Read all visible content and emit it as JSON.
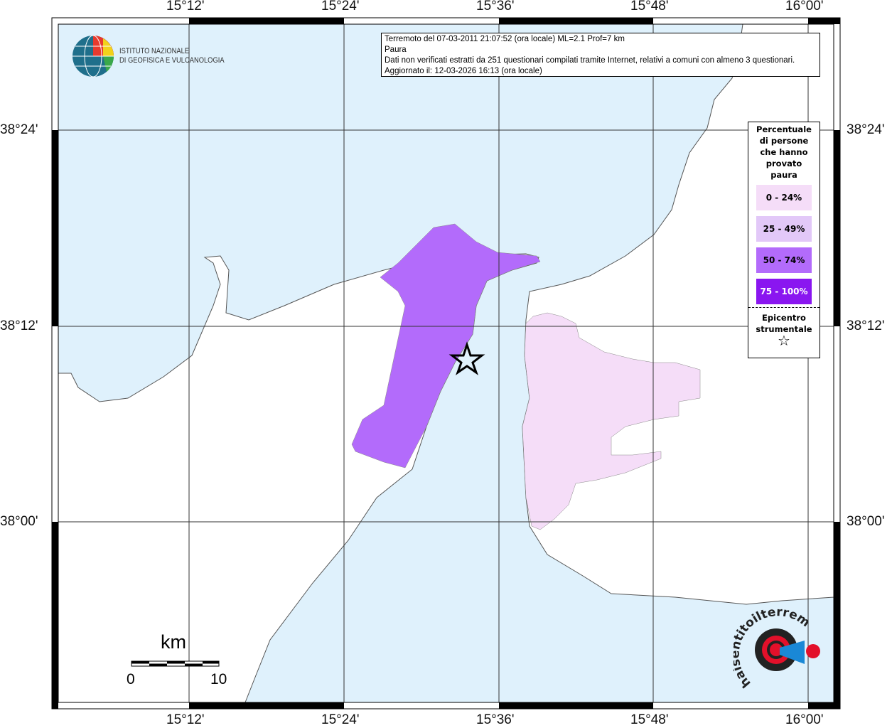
{
  "map": {
    "lon_ticks": [
      "15°12'",
      "15°24'",
      "15°36'",
      "15°48'",
      "16°00'"
    ],
    "lat_ticks": [
      "38°24'",
      "38°12'",
      "38°00'"
    ],
    "colors": {
      "sea": "#dff1fc",
      "land": "#ffffff",
      "class_0_24": "#f5ddf8",
      "class_25_49": "#e2c8f8",
      "class_50_74": "#b36bfb",
      "class_75_100": "#8a16f0"
    }
  },
  "logo": {
    "line1": "ISTITUTO NAZIONALE",
    "line2": "DI GEOFISICA E VULCANOLOGIA"
  },
  "info": {
    "line1": "Terremoto del 07-03-2011 21:07:52 (ora locale) ML=2.1 Prof=7 km",
    "line2": "Paura",
    "line3": "Dati non verificati estratti da 251 questionari compilati tramite Internet, relativi a comuni con almeno 3 questionari.",
    "line4": "Aggiornato il: 12-03-2026 16:13 (ora locale)"
  },
  "legend": {
    "title": "Percentuale di persone che hanno provato paura",
    "classes": [
      {
        "label": "0 - 24%",
        "color": "#f5ddf8"
      },
      {
        "label": "25 - 49%",
        "color": "#e2c8f8"
      },
      {
        "label": "50 - 74%",
        "color": "#b36bfb"
      },
      {
        "label": "75 - 100%",
        "color": "#8a16f0"
      }
    ],
    "epicenter_label": "Epicentro strumentale",
    "epicenter_icon": "star-icon"
  },
  "scale": {
    "unit": "km",
    "min": "0",
    "max": "10"
  },
  "brand": {
    "text": "haisentitoilterremoto.it www."
  }
}
